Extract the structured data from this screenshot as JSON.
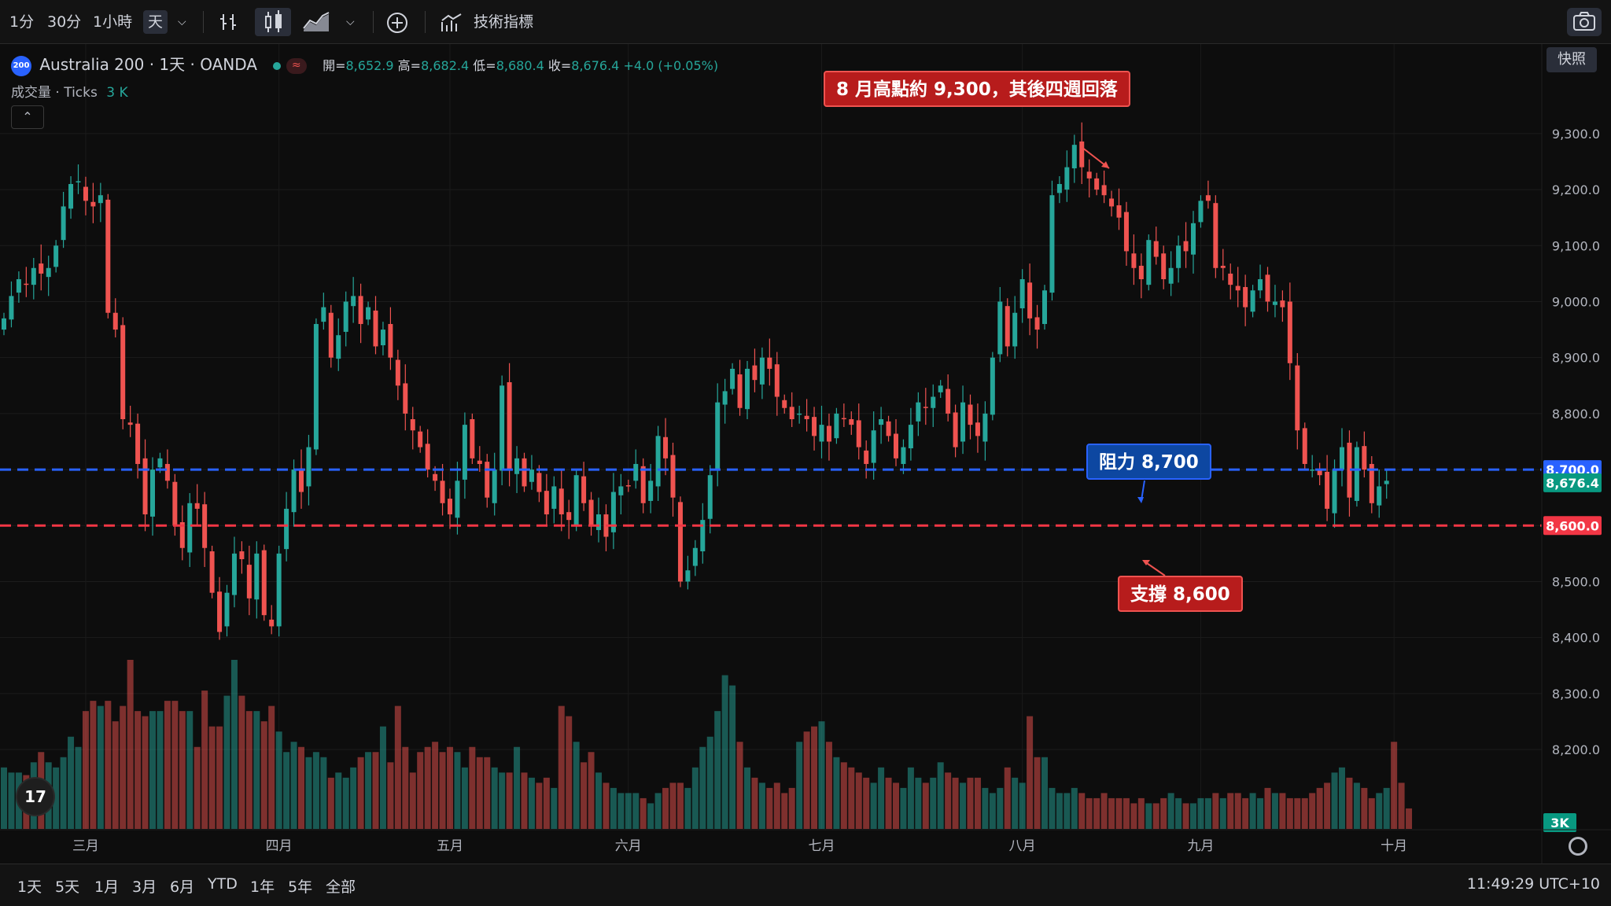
{
  "toolbar": {
    "intervals": [
      "1分",
      "30分",
      "1小時",
      "天"
    ],
    "indicators_label": "技術指標",
    "snapshot_tooltip": "快照"
  },
  "symbol": {
    "badge": "200",
    "title": "Australia 200 · 1天 · OANDA",
    "open_label": "開=",
    "open": "8,652.9",
    "high_label": "高=",
    "high": "8,682.4",
    "low_label": "低=",
    "low": "8,680.4",
    "close_label": "收=",
    "close": "8,676.4",
    "change": "+4.0 (+0.05%)"
  },
  "volume_pane": {
    "label": "成交量 · Ticks",
    "value": "3 K"
  },
  "annotations": {
    "high": "8 月高點約 9,300，其後四週回落",
    "resistance": "阻力 8,700",
    "support": "支撐 8,600"
  },
  "bottom": {
    "ranges": [
      "1天",
      "5天",
      "1月",
      "3月",
      "6月",
      "YTD",
      "1年",
      "5年",
      "全部"
    ],
    "clock": "11:49:29 UTC+10"
  },
  "colors": {
    "up": "#26a69a",
    "down": "#ef5350",
    "resistance_line": "#2962ff",
    "support_line": "#f23645",
    "background": "#0d0d0d"
  },
  "chart_data": {
    "type": "candlestick",
    "ylim": [
      8120,
      9460
    ],
    "y_ticks": [
      8200,
      8300,
      8400,
      8500,
      8600,
      8700,
      8800,
      8900,
      9000,
      9100,
      9200,
      9300
    ],
    "x_month_labels": [
      {
        "label": "三月",
        "index": 11
      },
      {
        "label": "四月",
        "index": 37
      },
      {
        "label": "五月",
        "index": 60
      },
      {
        "label": "六月",
        "index": 84
      },
      {
        "label": "七月",
        "index": 110
      },
      {
        "label": "八月",
        "index": 137
      },
      {
        "label": "九月",
        "index": 161
      },
      {
        "label": "十月",
        "index": 187
      }
    ],
    "levels": [
      {
        "name": "阻力",
        "value": 8700,
        "label": "8,700.0",
        "color": "#2962ff"
      },
      {
        "name": "支撐",
        "value": 8600,
        "label": "8,600.0",
        "color": "#f23645"
      }
    ],
    "last_price_label": "8,676.4",
    "last_price": 8676.4,
    "volume_axis_label": "3K",
    "closes": [
      8970,
      9010,
      9040,
      9030,
      9060,
      9050,
      9060,
      9100,
      9170,
      9210,
      9215,
      9180,
      9170,
      9190,
      8980,
      8950,
      8790,
      8780,
      8710,
      8620,
      8700,
      8720,
      8680,
      8600,
      8560,
      8640,
      8630,
      8560,
      8480,
      8410,
      8480,
      8550,
      8540,
      8470,
      8550,
      8440,
      8420,
      8550,
      8630,
      8700,
      8660,
      8740,
      8960,
      8990,
      8900,
      8940,
      9000,
      9010,
      8960,
      8990,
      8920,
      8950,
      8900,
      8850,
      8800,
      8770,
      8740,
      8700,
      8680,
      8640,
      8620,
      8680,
      8780,
      8720,
      8710,
      8650,
      8700,
      8850,
      8700,
      8720,
      8670,
      8700,
      8660,
      8620,
      8670,
      8620,
      8610,
      8690,
      8640,
      8600,
      8620,
      8580,
      8660,
      8670,
      8670,
      8710,
      8640,
      8680,
      8760,
      8720,
      8650,
      8500,
      8520,
      8560,
      8610,
      8690,
      8820,
      8840,
      8880,
      8810,
      8880,
      8860,
      8900,
      8880,
      8830,
      8810,
      8790,
      8800,
      8790,
      8760,
      8780,
      8750,
      8800,
      8790,
      8780,
      8740,
      8710,
      8770,
      8790,
      8760,
      8720,
      8740,
      8780,
      8820,
      8810,
      8830,
      8850,
      8800,
      8740,
      8820,
      8780,
      8760,
      8800,
      8900,
      9000,
      8920,
      8980,
      9040,
      8970,
      8950,
      9020,
      9190,
      9210,
      9240,
      9280,
      9240,
      9220,
      9200,
      9190,
      9170,
      9150,
      9090,
      9060,
      9040,
      9110,
      9080,
      9040,
      9060,
      9100,
      9090,
      9140,
      9180,
      9180,
      9060,
      9060,
      9030,
      9020,
      8990,
      9020,
      9040,
      9000,
      9000,
      8990,
      8890,
      8770,
      8710,
      8700,
      8690,
      8630,
      8700,
      8740,
      8650,
      8740,
      8700,
      8640,
      8670,
      8680
    ],
    "volumes": [
      1.2,
      1.1,
      1.1,
      1.05,
      1.3,
      1.5,
      1.3,
      1.2,
      1.4,
      1.8,
      1.6,
      2.3,
      2.5,
      2.4,
      2.5,
      2.1,
      2.4,
      3.3,
      2.3,
      2.2,
      2.3,
      2.3,
      2.5,
      2.5,
      2.3,
      2.3,
      1.6,
      2.7,
      2.0,
      2.0,
      2.6,
      3.3,
      2.6,
      2.3,
      2.3,
      2.1,
      2.4,
      1.9,
      1.5,
      1.7,
      1.6,
      1.4,
      1.5,
      1.4,
      1.0,
      1.1,
      1.0,
      1.2,
      1.4,
      1.5,
      1.5,
      2.0,
      1.3,
      2.4,
      1.6,
      1.1,
      1.5,
      1.6,
      1.7,
      1.5,
      1.6,
      1.5,
      1.2,
      1.6,
      1.4,
      1.4,
      1.2,
      1.1,
      1.1,
      1.6,
      1.1,
      1.0,
      0.9,
      1.0,
      0.8,
      2.4,
      2.2,
      1.7,
      1.3,
      1.5,
      1.1,
      0.9,
      0.8,
      0.7,
      0.7,
      0.7,
      0.6,
      0.5,
      0.7,
      0.8,
      0.9,
      0.9,
      0.8,
      1.2,
      1.6,
      1.8,
      2.3,
      3.0,
      2.8,
      1.7,
      1.2,
      1.0,
      0.9,
      0.8,
      0.9,
      0.7,
      0.8,
      1.7,
      1.9,
      2.0,
      2.1,
      1.7,
      1.4,
      1.3,
      1.2,
      1.1,
      1.0,
      0.9,
      1.2,
      1.0,
      0.9,
      0.8,
      1.2,
      1.0,
      0.9,
      1.0,
      1.3,
      1.1,
      1.0,
      0.9,
      1.0,
      1.0,
      0.8,
      0.7,
      0.8,
      1.2,
      1.0,
      0.9,
      2.2,
      1.4,
      1.4,
      0.8,
      0.7,
      0.7,
      0.8,
      0.7,
      0.6,
      0.6,
      0.7,
      0.6,
      0.6,
      0.6,
      0.5,
      0.6,
      0.5,
      0.5,
      0.6,
      0.7,
      0.6,
      0.5,
      0.5,
      0.6,
      0.6,
      0.7,
      0.6,
      0.7,
      0.7,
      0.6,
      0.7,
      0.6,
      0.8,
      0.7,
      0.7,
      0.6,
      0.6,
      0.6,
      0.7,
      0.8,
      0.9,
      1.1,
      1.2,
      1.0,
      0.9,
      0.8,
      0.6,
      0.7,
      0.8,
      1.7,
      0.9,
      0.4
    ],
    "volume_max_k": 3.3
  }
}
